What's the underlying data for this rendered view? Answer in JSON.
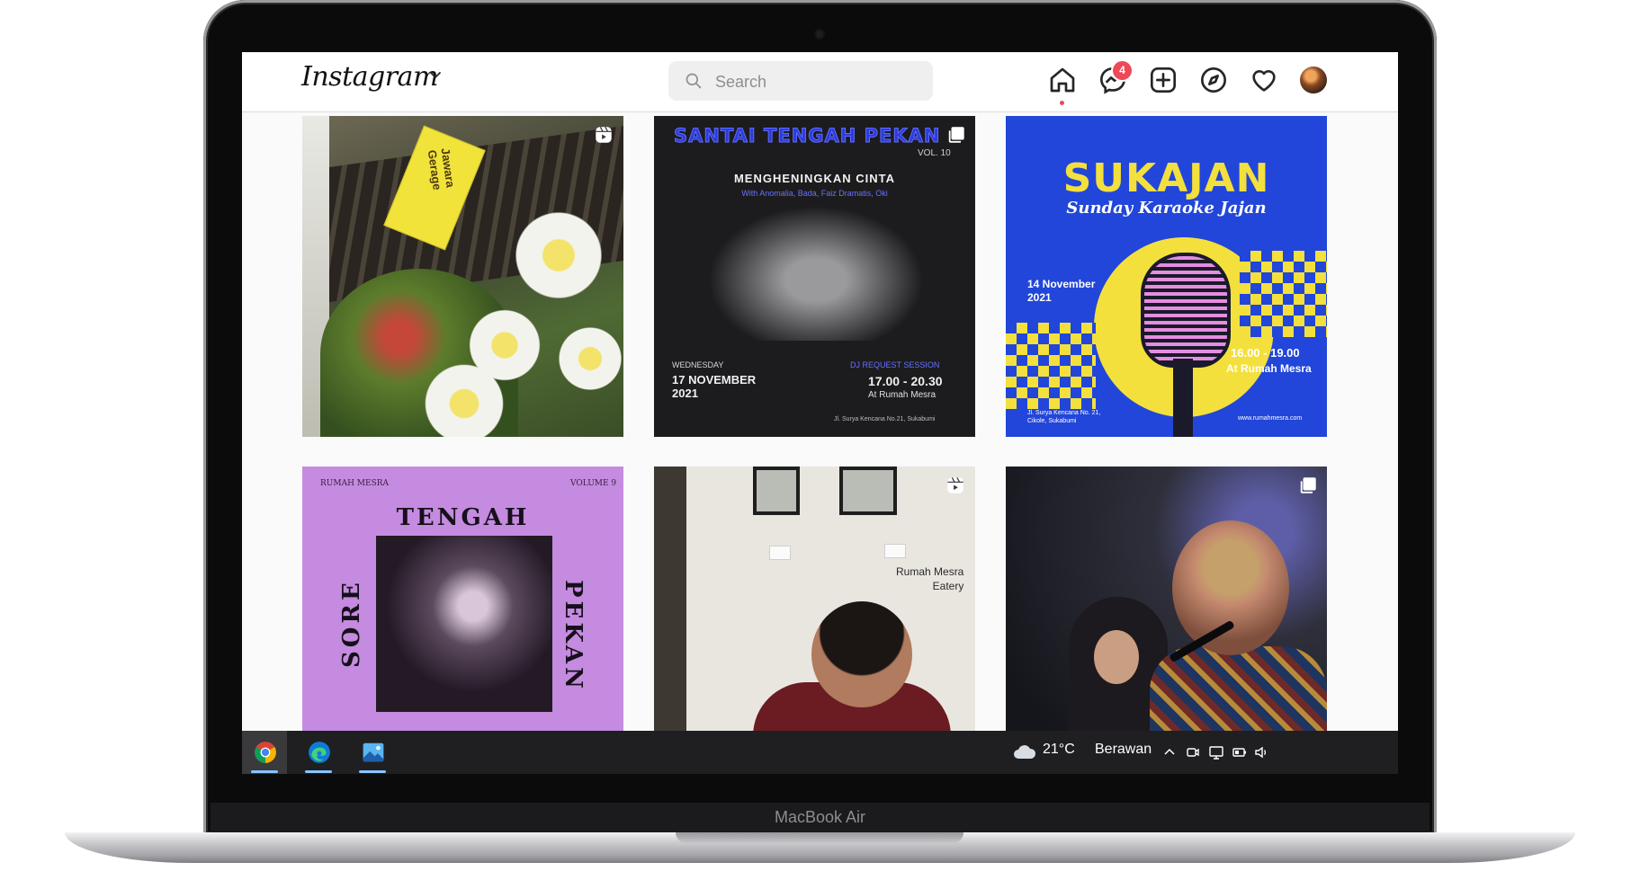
{
  "device": {
    "label": "MacBook Air"
  },
  "instagram": {
    "logo": "Instagram",
    "search": {
      "placeholder": "Search"
    },
    "nav": {
      "messages_badge": "4",
      "icons": [
        "home-icon",
        "messenger-icon",
        "new-post-icon",
        "explore-icon",
        "activity-heart-icon",
        "profile-avatar"
      ]
    },
    "accent": "#ed4956"
  },
  "posts": [
    {
      "type": "reel",
      "sign_text": "Jawara Gerage"
    },
    {
      "type": "multi",
      "title": "SANTAI TENGAH PEKAN",
      "volume": "VOL. 10",
      "heading": "MENGHENINGKAN CINTA",
      "with": "With Anomalia, Bada, Faiz Dramatis, Oki",
      "day": "WEDNESDAY",
      "date": "17 NOVEMBER\n2021",
      "session": "DJ REQUEST SESSION",
      "time": "17.00 - 20.30",
      "venue": "At Rumah Mesra",
      "address": "Jl. Surya Kencana No.21, Sukabumi"
    },
    {
      "type": "single",
      "title": "SUKAJAN",
      "subtitle": "Sunday Karaoke Jajan",
      "date": "14 November\n2021",
      "time": "16.00 - 19.00",
      "venue": "At Rumah Mesra",
      "address": "Jl. Surya Kencana No. 21,\nCikole, Sukabumi",
      "website": "www.rumahmesra.com",
      "colors": {
        "blue": "#2246d9",
        "yellow": "#f3e03c"
      }
    },
    {
      "type": "single",
      "brand": "RUMAH MESRA",
      "volume": "VOLUME 9",
      "title": "TENGAH",
      "left": "SORE",
      "right": "PEKAN",
      "color": "#c58be0"
    },
    {
      "type": "reel",
      "label": "Rumah Mesra\nEatery"
    },
    {
      "type": "multi"
    }
  ],
  "taskbar": {
    "apps": [
      "chrome-icon",
      "edge-icon",
      "photos-icon"
    ],
    "weather": {
      "temp": "21°C",
      "condition": "Berawan"
    }
  }
}
